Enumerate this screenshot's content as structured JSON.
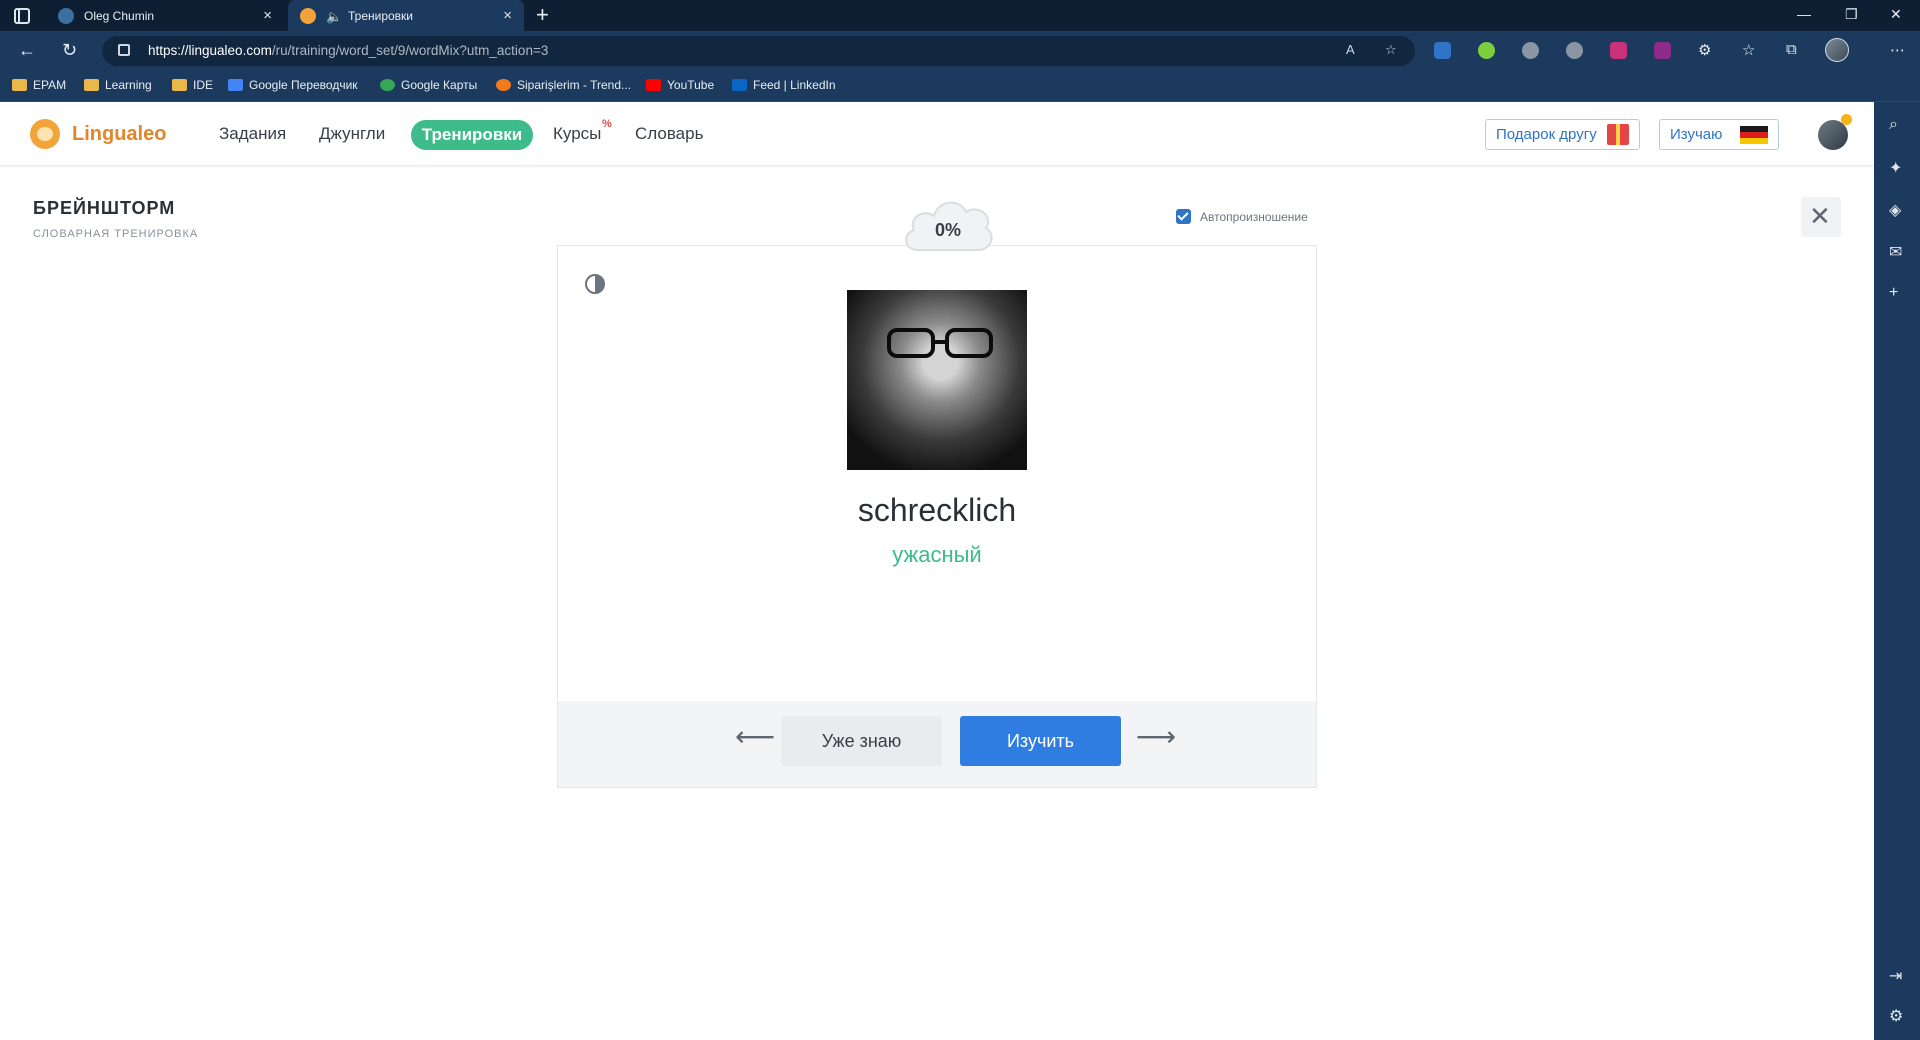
{
  "browser": {
    "tabs": [
      {
        "title": "Oleg Chumin",
        "close": "×"
      },
      {
        "title": "Тренировки",
        "close": "×"
      }
    ],
    "new_tab": "+",
    "window_controls": {
      "minimize": "—",
      "restore": "❐",
      "close": "✕"
    },
    "url_host": "https://lingualeo.com",
    "url_path": "/ru/training/word_set/9/wordMix?utm_action=3",
    "bookmarks": [
      {
        "label": "EPAM",
        "icon": "folder-icon"
      },
      {
        "label": "Learning",
        "icon": "folder-icon"
      },
      {
        "label": "IDE",
        "icon": "folder-icon"
      },
      {
        "label": "Google Переводчик",
        "icon": "google-translate-icon"
      },
      {
        "label": "Google Карты",
        "icon": "google-maps-icon"
      },
      {
        "label": "Siparişlerim - Trend...",
        "icon": "trendyol-icon"
      },
      {
        "label": "YouTube",
        "icon": "youtube-icon"
      },
      {
        "label": "Feed | LinkedIn",
        "icon": "linkedin-icon"
      }
    ]
  },
  "site": {
    "logo": "Lingualeo",
    "nav": {
      "tasks": "Задания",
      "jungle": "Джунгли",
      "training": "Тренировки",
      "courses": "Курсы",
      "courses_badge": "%",
      "dictionary": "Словарь"
    },
    "gift_button": "Подарок другу",
    "learning_button": "Изучаю"
  },
  "training": {
    "title": "БРЕЙНШТОРМ",
    "subtitle": "СЛОВАРНАЯ ТРЕНИРОВКА",
    "progress": "0%",
    "autoplay_label": "Автопроизношение",
    "autoplay_checked": true,
    "word": "schrecklich",
    "translation": "ужасный",
    "prev_arrow": "⟵",
    "next_arrow": "⟶",
    "know_button": "Уже знаю",
    "learn_button": "Изучить"
  },
  "colors": {
    "brand_orange": "#e3852b",
    "accent_green": "#3dbb8a",
    "primary_blue": "#2f7de1",
    "chrome_dark": "#0f1f33",
    "chrome_bar": "#1c3a5e"
  }
}
